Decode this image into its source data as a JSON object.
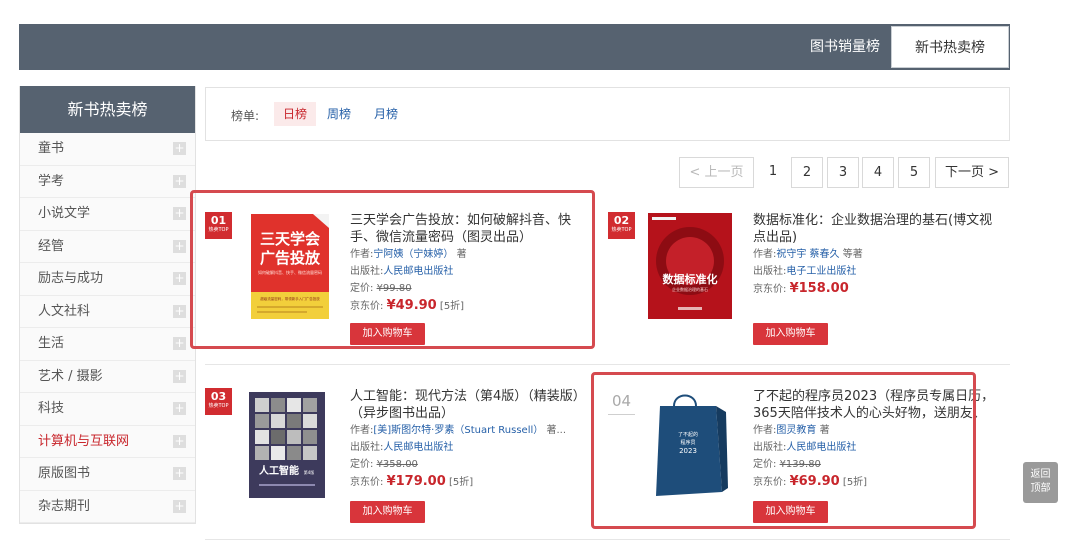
{
  "top_tabs": {
    "sales": "图书销量榜",
    "new": "新书热卖榜"
  },
  "sidebar": {
    "title": "新书热卖榜",
    "items": [
      "童书",
      "学考",
      "小说文学",
      "经管",
      "励志与成功",
      "人文社科",
      "生活",
      "艺术 / 摄影",
      "科技",
      "计算机与互联网",
      "原版图书",
      "杂志期刊"
    ],
    "active": "计算机与互联网",
    "plus": "+"
  },
  "filter": {
    "label": "榜单:",
    "options": [
      "日榜",
      "周榜",
      "月榜"
    ],
    "selected": "日榜"
  },
  "pager": {
    "prev": "< 上一页",
    "pages": [
      "1",
      "2",
      "3",
      "4",
      "5"
    ],
    "current": "1",
    "next": "下一页 >"
  },
  "labels": {
    "author": "作者:",
    "publisher": "出版社:",
    "list_price": "定价:",
    "jd_price": "京东价:",
    "add_to_cart": "加入购物车",
    "back_top_1": "返回",
    "back_top_2": "顶部"
  },
  "books": [
    {
      "rank": "01",
      "rank_sub": "热卖TOP",
      "title": "三天学会广告投放：如何破解抖音、快手、微信流量密码（图灵出品）",
      "author": "宁阿姨（宁妹婷）",
      "author_suffix": "著",
      "publisher": "人民邮电出版社",
      "list_price": "¥99.80",
      "jd_price": "¥49.90",
      "discount": "[5折]",
      "cover": {
        "title1": "三天学会",
        "title2": "广告投放",
        "subtitle": "如何破解抖音、快手、微信流量密码",
        "banner": "超级流量密码，带领新手入门广告投放"
      }
    },
    {
      "rank": "02",
      "rank_sub": "热卖TOP",
      "title": "数据标准化：企业数据治理的基石(博文视点出品)",
      "author": "祝守宇  蔡春久",
      "author_suffix": "等著",
      "publisher": "电子工业出版社",
      "list_price": "",
      "jd_price": "¥158.00",
      "discount": "",
      "cover": {
        "title": "数据标准化",
        "subtitle": "企业数据治理的基石"
      }
    },
    {
      "rank": "03",
      "rank_sub": "热卖TOP",
      "title": "人工智能：现代方法（第4版）（精装版）（异步图书出品）",
      "author": "[美]斯图尔特·罗素（Stuart  Russell）",
      "author_suffix": "著...",
      "publisher": "人民邮电出版社",
      "list_price": "¥358.00",
      "jd_price": "¥179.00",
      "discount": "[5折]",
      "cover": {
        "title": "人工智能",
        "edition": "第4版"
      }
    },
    {
      "rank": "04",
      "rank_sub": "",
      "title": "了不起的程序员2023（程序员专属日历，365天陪伴技术人的心头好物，送朋友、送...",
      "author": "图灵教育",
      "author_suffix": "著",
      "publisher": "人民邮电出版社",
      "list_price": "¥139.80",
      "jd_price": "¥69.90",
      "discount": "[5折]",
      "cover": {
        "title1": "了不起的",
        "title2": "程序员",
        "year": "2023"
      }
    }
  ],
  "colors": {
    "accent": "#c8262c",
    "header_bg": "#566270",
    "link": "#2660a8",
    "highlight_border": "#d54a4f"
  }
}
